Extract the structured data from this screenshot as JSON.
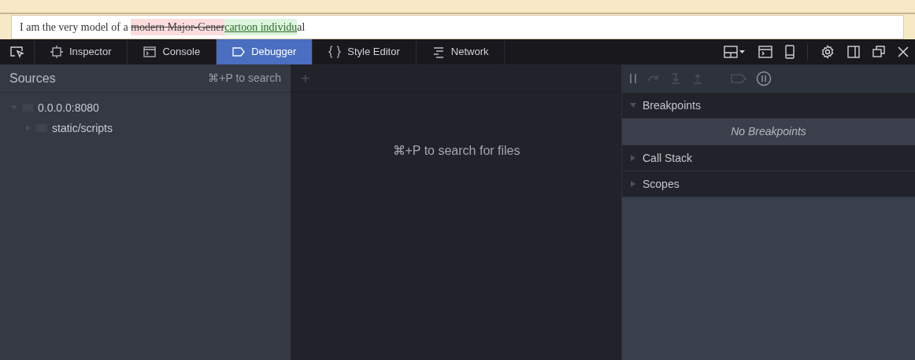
{
  "editor": {
    "segments": [
      {
        "kind": "plain",
        "text": "I am the very model of a "
      },
      {
        "kind": "deleted",
        "text": "modern Major-Gener"
      },
      {
        "kind": "inserted",
        "text": "cartoon individu"
      },
      {
        "kind": "plain",
        "text": "al"
      }
    ]
  },
  "tabs": [
    {
      "label": "Inspector",
      "selected": false
    },
    {
      "label": "Console",
      "selected": false
    },
    {
      "label": "Debugger",
      "selected": true
    },
    {
      "label": "Style Editor",
      "selected": false
    },
    {
      "label": "Network",
      "selected": false
    }
  ],
  "sources": {
    "title": "Sources",
    "shortcut": "⌘+P to search",
    "tree": [
      {
        "label": "0.0.0.0:8080",
        "expanded": true,
        "children": [
          {
            "label": "static/scripts",
            "expanded": false
          }
        ]
      }
    ]
  },
  "editor_pane": {
    "add_tab": "+",
    "hint": "⌘+P to search for files"
  },
  "sidebar": {
    "sections": [
      {
        "title": "Breakpoints",
        "expanded": true,
        "empty_text": "No Breakpoints"
      },
      {
        "title": "Call Stack",
        "expanded": false
      },
      {
        "title": "Scopes",
        "expanded": false
      }
    ]
  }
}
